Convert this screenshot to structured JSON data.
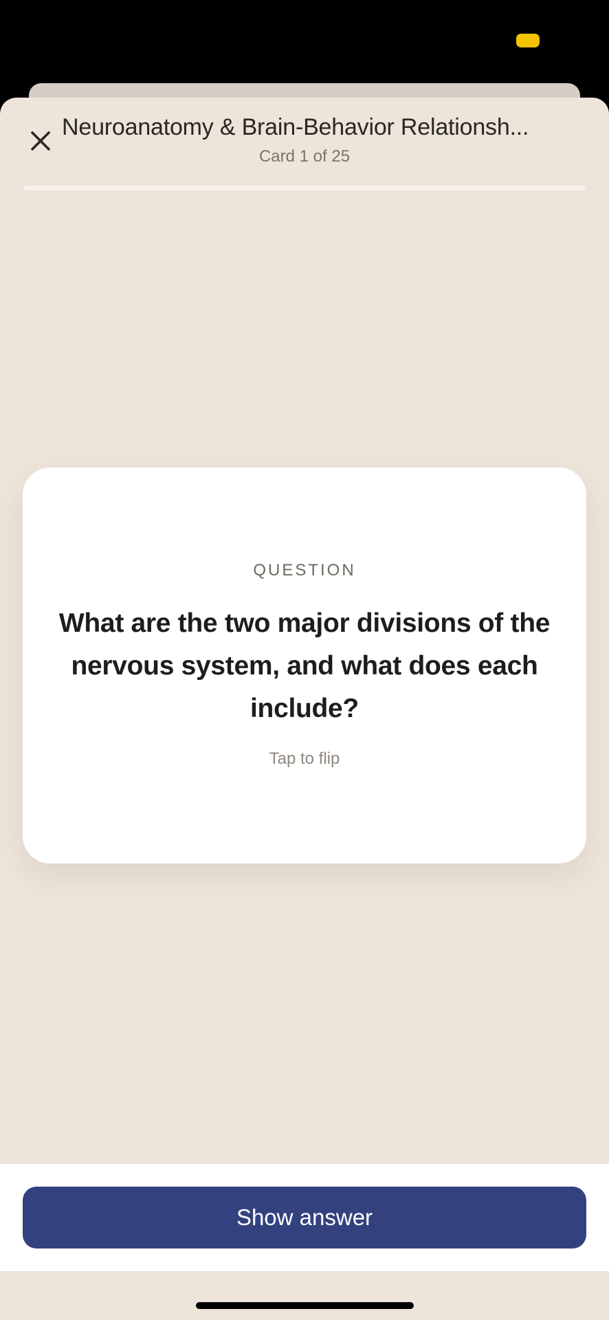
{
  "header": {
    "title": "Neuroanatomy & Brain-Behavior Relationsh...",
    "subtitle": "Card 1 of 25",
    "close_icon": "close-icon",
    "progress_fraction": 0.0
  },
  "card": {
    "label": "QUESTION",
    "question": "What are the two major divisions of the nervous system, and what does each include?",
    "hint": "Tap to flip"
  },
  "footer": {
    "show_answer_label": "Show answer"
  },
  "colors": {
    "background": "#ede4da",
    "card": "#ffffff",
    "accent": "#33427e",
    "status_indicator": "#f5c400"
  }
}
